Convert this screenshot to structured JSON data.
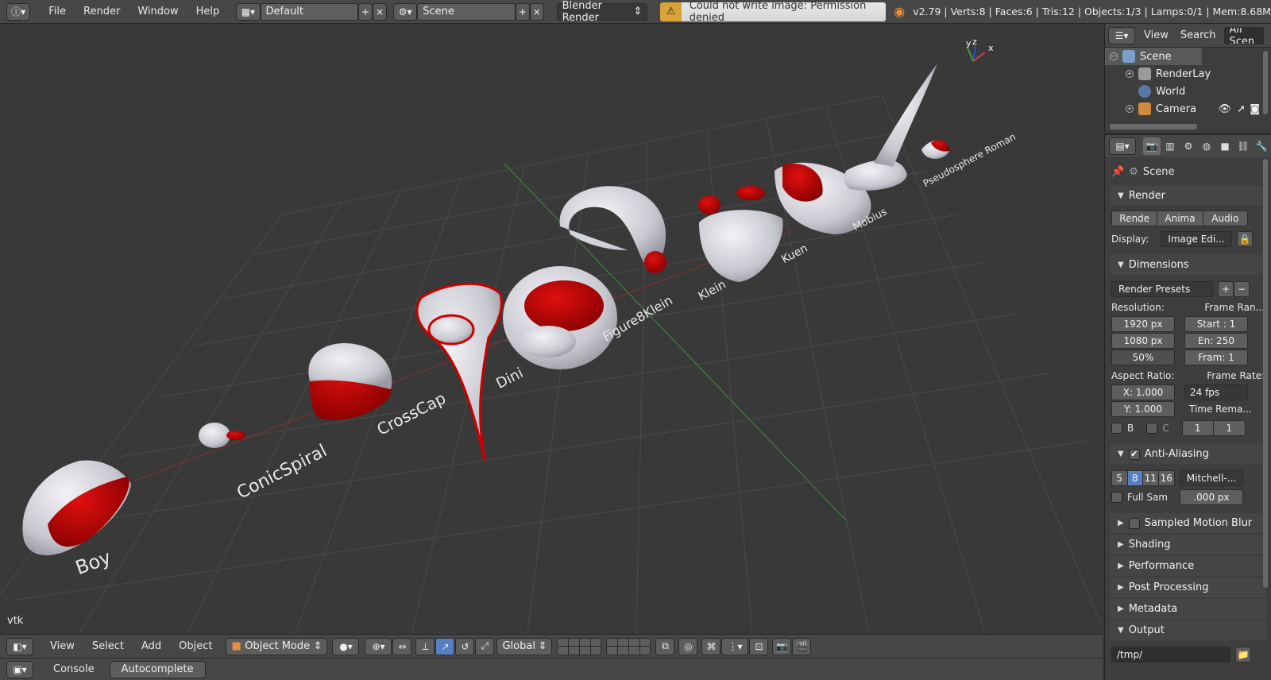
{
  "topbar": {
    "menus": [
      "File",
      "Render",
      "Window",
      "Help"
    ],
    "layout": "Default",
    "scene": "Scene",
    "engine": "Blender Render",
    "warning": "Could not write image: Permission denied",
    "stats": "v2.79 | Verts:8 | Faces:6 | Tris:12 | Objects:1/3 | Lamps:0/1 | Mem:8.68M"
  },
  "viewport": {
    "label": "vtk",
    "axis_labels": {
      "x": "x",
      "y": "y",
      "z": "z"
    },
    "objects": [
      "Boy",
      "ConicSpiral",
      "CrossCap",
      "Dini",
      "Figure8Klein",
      "Klein",
      "Kuen",
      "Mobius",
      "Pseudosphere Roman"
    ]
  },
  "vp_header": {
    "menus": [
      "View",
      "Select",
      "Add",
      "Object"
    ],
    "mode": "Object Mode",
    "orientation": "Global"
  },
  "console_bar": {
    "console": "Console",
    "autocomplete": "Autocomplete"
  },
  "outliner": {
    "header": {
      "view": "View",
      "search": "Search",
      "filter": "All Scen"
    },
    "items": [
      "Scene",
      "RenderLay",
      "World",
      "Camera"
    ]
  },
  "properties": {
    "context": "Scene",
    "render": {
      "title": "Render",
      "buttons": [
        "Rende",
        "Anima",
        "Audio"
      ],
      "display_label": "Display:",
      "display_value": "Image Edi..."
    },
    "dimensions": {
      "title": "Dimensions",
      "presets": "Render Presets",
      "resolution_label": "Resolution:",
      "res_x": "1920 px",
      "res_y": "1080 px",
      "res_pct": "50%",
      "frame_range_label": "Frame Ran...",
      "start": "Start : 1",
      "end": "En: 250",
      "frame": "Fram:  1",
      "aspect_label": "Aspect Ratio:",
      "aspect_x": "X: 1.000",
      "aspect_y": "Y: 1.000",
      "frame_rate_label": "Frame Rate:",
      "fps": "24 fps",
      "time_remap_label": "Time Rema...",
      "b": "B",
      "c": "C",
      "remap_old": "1",
      "remap_new": "1"
    },
    "antialiasing": {
      "title": "Anti-Aliasing",
      "samples": [
        "5",
        "8",
        "11",
        "16"
      ],
      "filter": "Mitchell-...",
      "full_sample": "Full Sam",
      "size": ".000 px"
    },
    "panels": [
      "Sampled Motion Blur",
      "Shading",
      "Performance",
      "Post Processing",
      "Metadata",
      "Output"
    ],
    "output_path": "/tmp/"
  },
  "colors": {
    "header_bg": "#474747",
    "viewport_bg": "#393939",
    "grid": "#4a4a4a",
    "accent_blue": "#5680c2",
    "object_red": "#c00000",
    "object_white": "#d8d8e0"
  }
}
